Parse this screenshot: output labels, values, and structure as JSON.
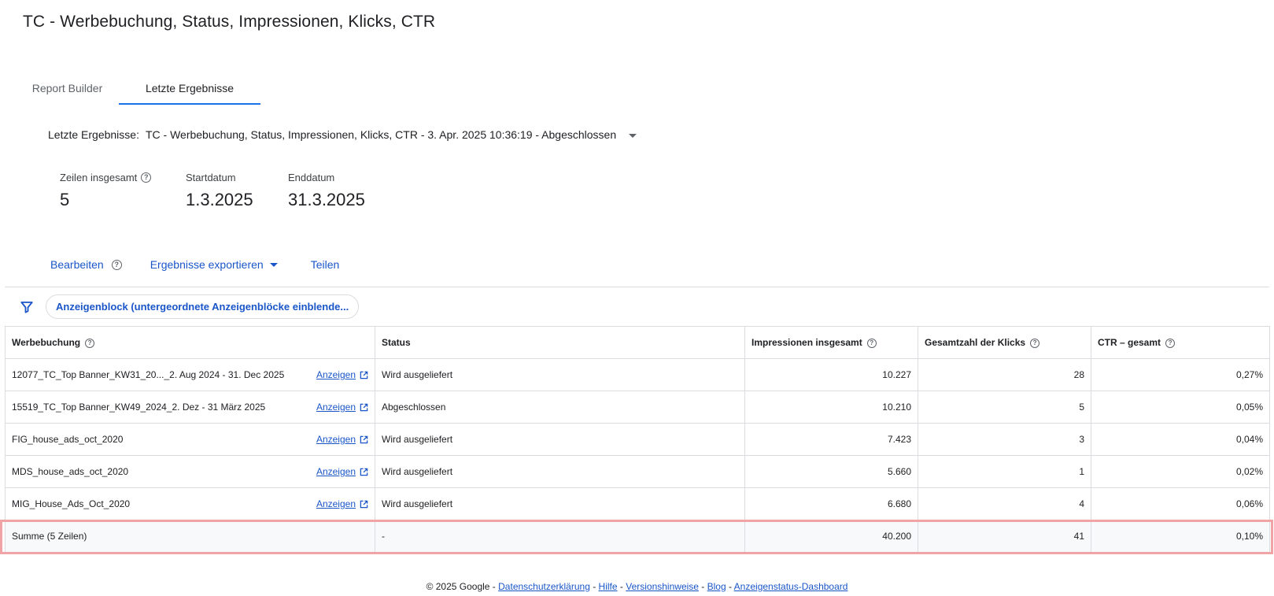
{
  "page": {
    "title": "TC - Werbebuchung, Status, Impressionen, Klicks, CTR"
  },
  "tabs": [
    {
      "label": "Report Builder"
    },
    {
      "label": "Letzte Ergebnisse"
    }
  ],
  "result_select": {
    "label": "Letzte Ergebnisse:",
    "value": "TC - Werbebuchung, Status, Impressionen, Klicks, CTR - 3. Apr. 2025 10:36:19 - Abgeschlossen"
  },
  "stats": {
    "rows_label": "Zeilen insgesamt",
    "rows_value": "5",
    "start_label": "Startdatum",
    "start_value": "1.3.2025",
    "end_label": "Enddatum",
    "end_value": "31.3.2025"
  },
  "actions": {
    "edit": "Bearbeiten",
    "export": "Ergebnisse exportieren",
    "share": "Teilen"
  },
  "filter": {
    "chip": "Anzeigenblock (untergeordnete Anzeigenblöcke einblende..."
  },
  "table": {
    "headers": [
      "Werbebuchung",
      "Status",
      "Impressionen insgesamt",
      "Gesamtzahl der Klicks",
      "CTR – gesamt"
    ],
    "view_label": "Anzeigen",
    "rows": [
      {
        "name": "12077_TC_Top Banner_KW31_20..._2. Aug 2024 - 31. Dec 2025",
        "status": "Wird ausgeliefert",
        "impressions": "10.227",
        "clicks": "28",
        "ctr": "0,27%"
      },
      {
        "name": "15519_TC_Top Banner_KW49_2024_2. Dez - 31 März 2025",
        "status": "Abgeschlossen",
        "impressions": "10.210",
        "clicks": "5",
        "ctr": "0,05%"
      },
      {
        "name": "FIG_house_ads_oct_2020",
        "status": "Wird ausgeliefert",
        "impressions": "7.423",
        "clicks": "3",
        "ctr": "0,04%"
      },
      {
        "name": "MDS_house_ads_oct_2020",
        "status": "Wird ausgeliefert",
        "impressions": "5.660",
        "clicks": "1",
        "ctr": "0,02%"
      },
      {
        "name": "MIG_House_Ads_Oct_2020",
        "status": "Wird ausgeliefert",
        "impressions": "6.680",
        "clicks": "4",
        "ctr": "0,06%"
      }
    ],
    "total": {
      "name": "Summe (5 Zeilen)",
      "status": "-",
      "impressions": "40.200",
      "clicks": "41",
      "ctr": "0,10%"
    }
  },
  "footer": {
    "copyright": "© 2025 Google - ",
    "links": [
      "Datenschutzerklärung",
      "Hilfe",
      "Versionshinweise",
      "Blog",
      "Anzeigenstatus-Dashboard"
    ]
  },
  "colors": {
    "accent": "#1a73e8",
    "link": "#1a56c8",
    "highlight": "#f1a4a6"
  }
}
